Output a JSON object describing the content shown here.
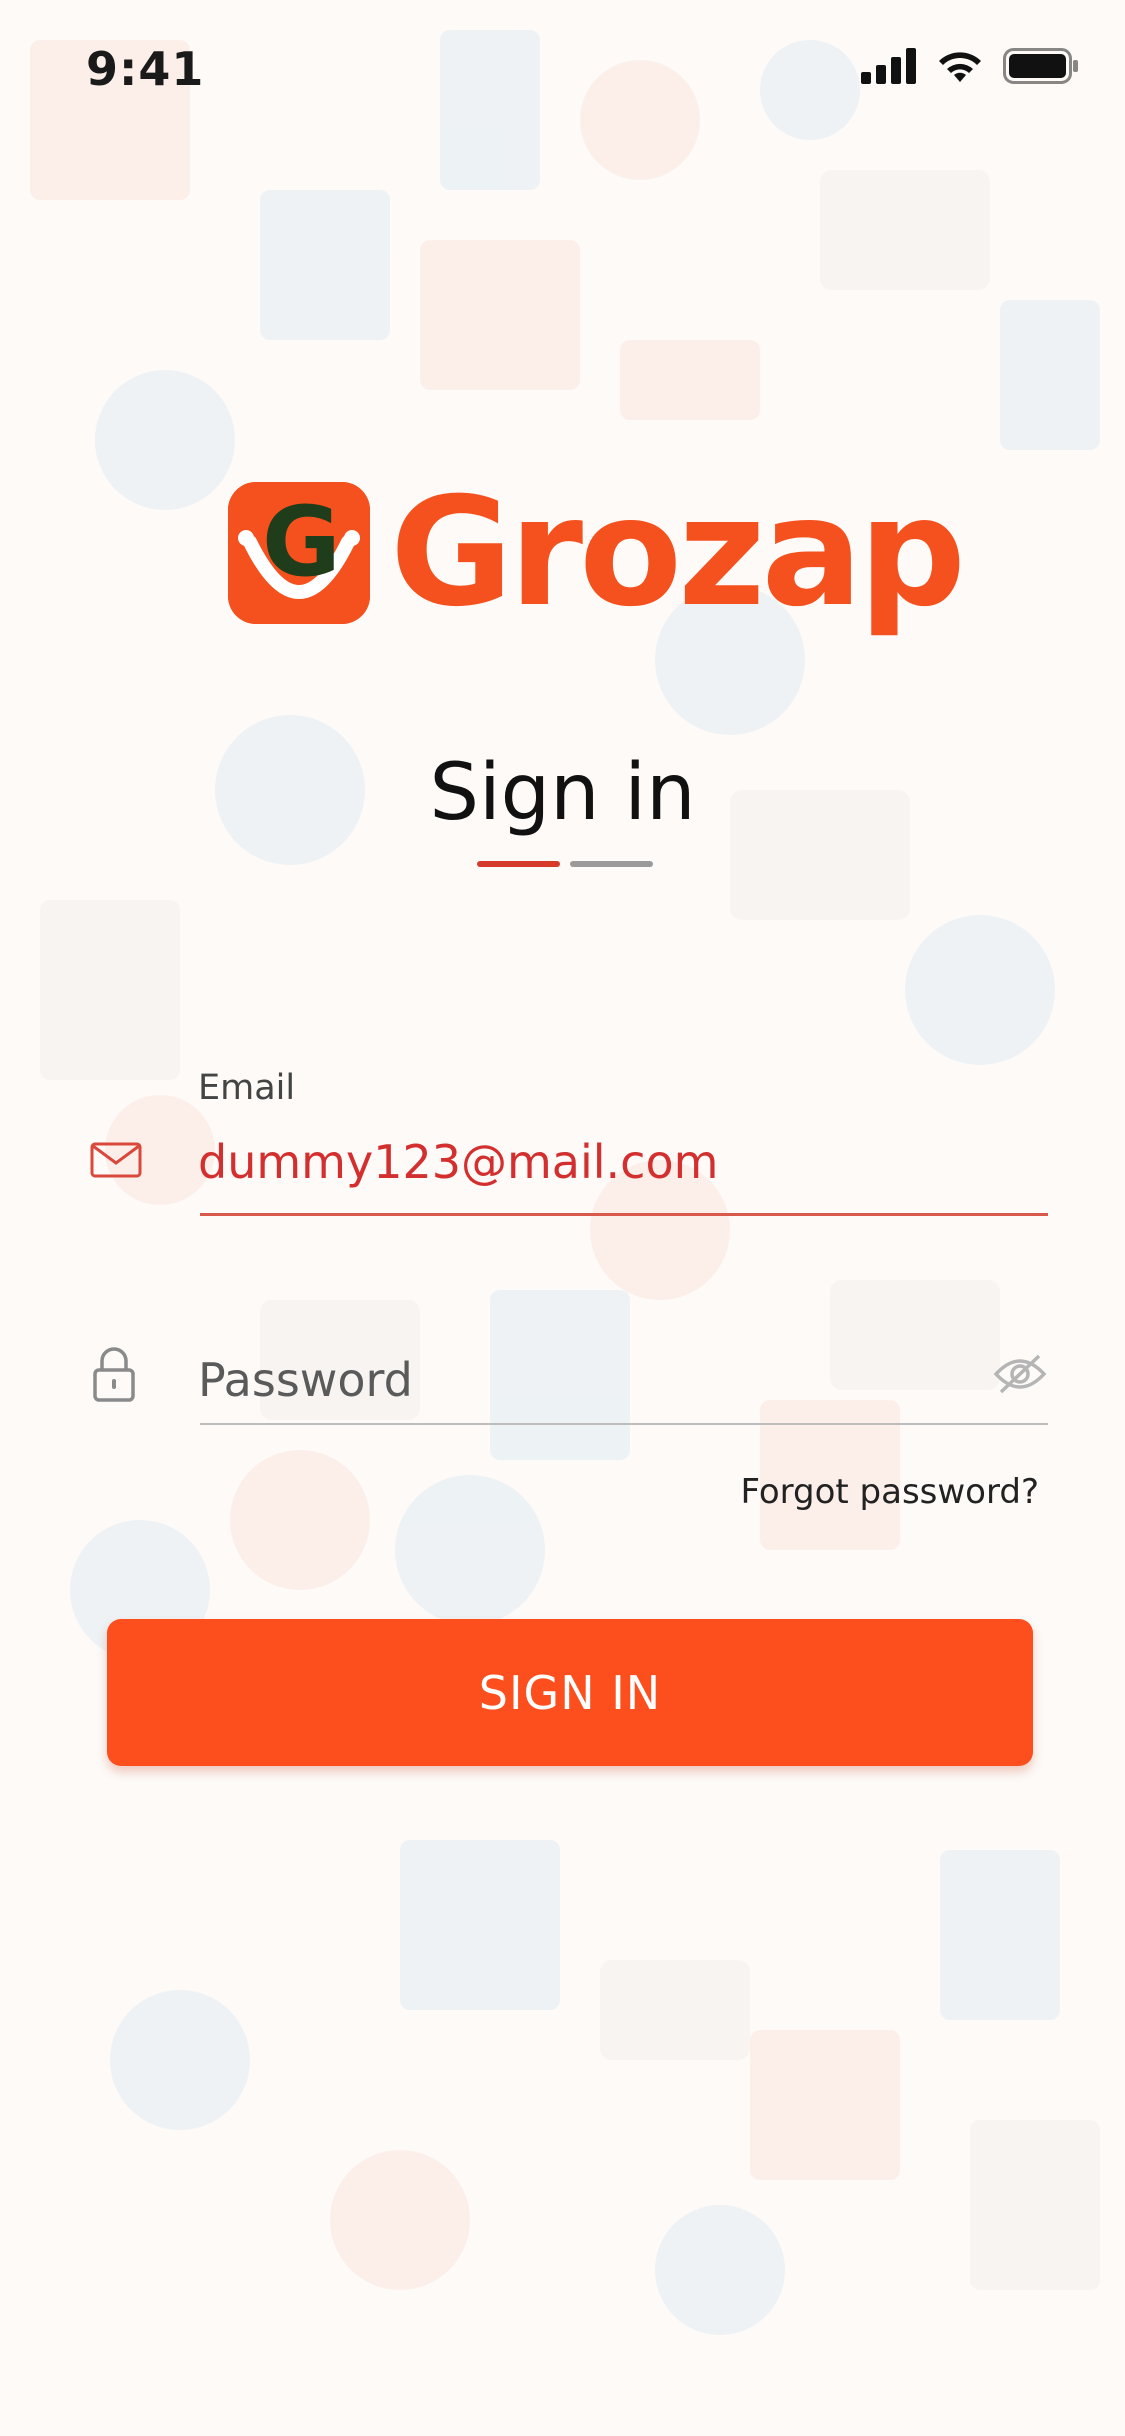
{
  "status_bar": {
    "time": "9:41"
  },
  "logo": {
    "mark_letter": "G",
    "wordmark": "Grozap"
  },
  "title": "Sign in",
  "email": {
    "label": "Email",
    "value": "dummy123@mail.com"
  },
  "password": {
    "placeholder": "Password"
  },
  "forgot_password": "Forgot password?",
  "sign_in_button": "SIGN IN",
  "colors": {
    "brand": "#f5511e",
    "button": "#fd4e1d",
    "accent_red": "#d32f2f"
  }
}
